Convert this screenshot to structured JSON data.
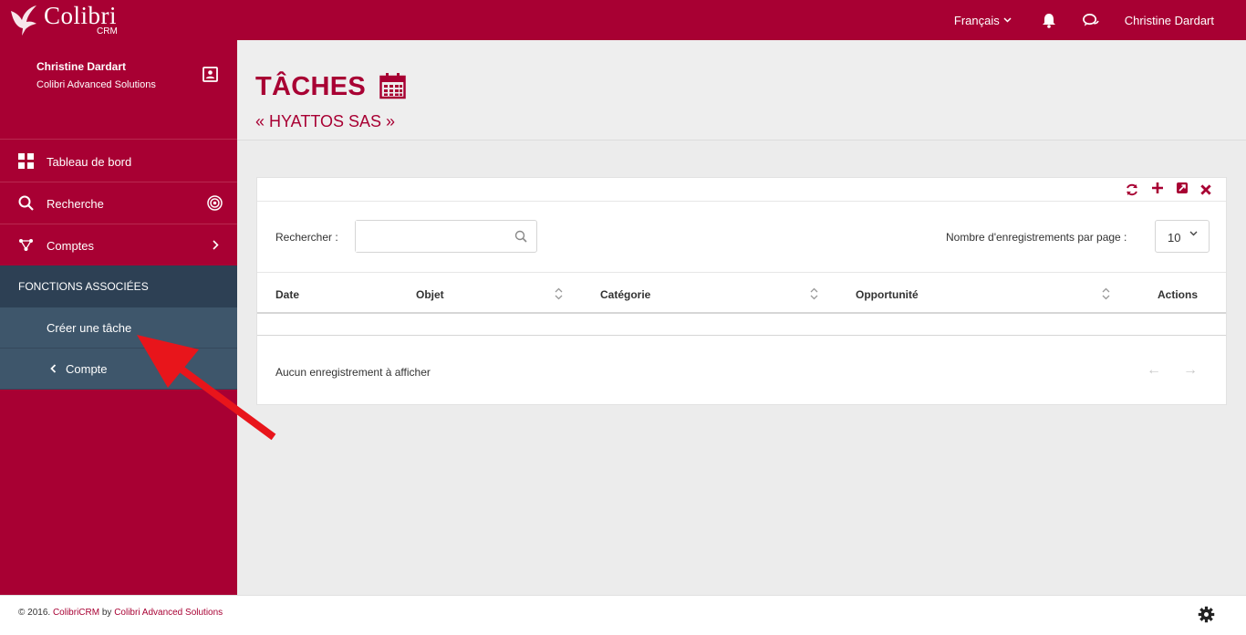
{
  "topbar": {
    "brand": "Colibri",
    "brand_sub": "CRM",
    "language": "Français",
    "user": "Christine Dardart"
  },
  "sidebar": {
    "profile": {
      "name": "Christine Dardart",
      "company": "Colibri Advanced Solutions"
    },
    "nav": [
      {
        "label": "Tableau de bord",
        "icon": "dashboard-icon"
      },
      {
        "label": "Recherche",
        "icon": "search-icon"
      },
      {
        "label": "Comptes",
        "icon": "accounts-icon"
      }
    ],
    "section_title": "FONCTIONS ASSOCIÉES",
    "sub_items": [
      {
        "label": "Créer une tâche"
      },
      {
        "label": "Compte"
      }
    ]
  },
  "header": {
    "title": "TÂCHES",
    "subtitle": "« HYATTOS SAS »"
  },
  "panel": {
    "search_label": "Rechercher :",
    "search_value": "",
    "per_page_label": "Nombre d'enregistrements par page :",
    "per_page_value": "10",
    "columns": [
      "Date",
      "Objet",
      "Catégorie",
      "Opportunité",
      "Actions"
    ],
    "empty_message": "Aucun enregistrement à afficher",
    "prev": "←",
    "next": "→"
  },
  "footer": {
    "copyright": "© 2016.",
    "product": "ColibriCRM",
    "by": "by",
    "company": "Colibri Advanced Solutions"
  },
  "colors": {
    "brand": "#a80033",
    "sidebar_section": "#2d4054",
    "sidebar_sub": "#3e566b",
    "arrow": "#e8151b"
  }
}
